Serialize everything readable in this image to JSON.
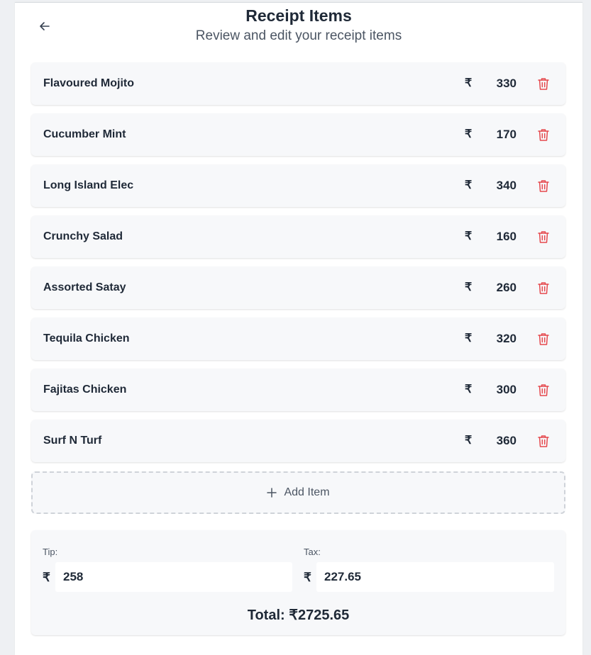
{
  "header": {
    "title": "Receipt Items",
    "subtitle": "Review and edit your receipt items"
  },
  "currency_symbol": "₹",
  "items": [
    {
      "name": "Flavoured Mojito",
      "price": "330"
    },
    {
      "name": "Cucumber Mint",
      "price": "170"
    },
    {
      "name": "Long Island Elec",
      "price": "340"
    },
    {
      "name": "Crunchy Salad",
      "price": "160"
    },
    {
      "name": "Assorted Satay",
      "price": "260"
    },
    {
      "name": "Tequila Chicken",
      "price": "320"
    },
    {
      "name": "Fajitas Chicken",
      "price": "300"
    },
    {
      "name": "Surf N Turf",
      "price": "360"
    }
  ],
  "add_item_label": "Add Item",
  "summary": {
    "tip_label": "Tip:",
    "tip_value": "258",
    "tax_label": "Tax:",
    "tax_value": "227.65",
    "total_text": "Total: ₹2725.65"
  },
  "colors": {
    "delete_icon": "#e5484d",
    "row_background": "#f7f8fa"
  }
}
